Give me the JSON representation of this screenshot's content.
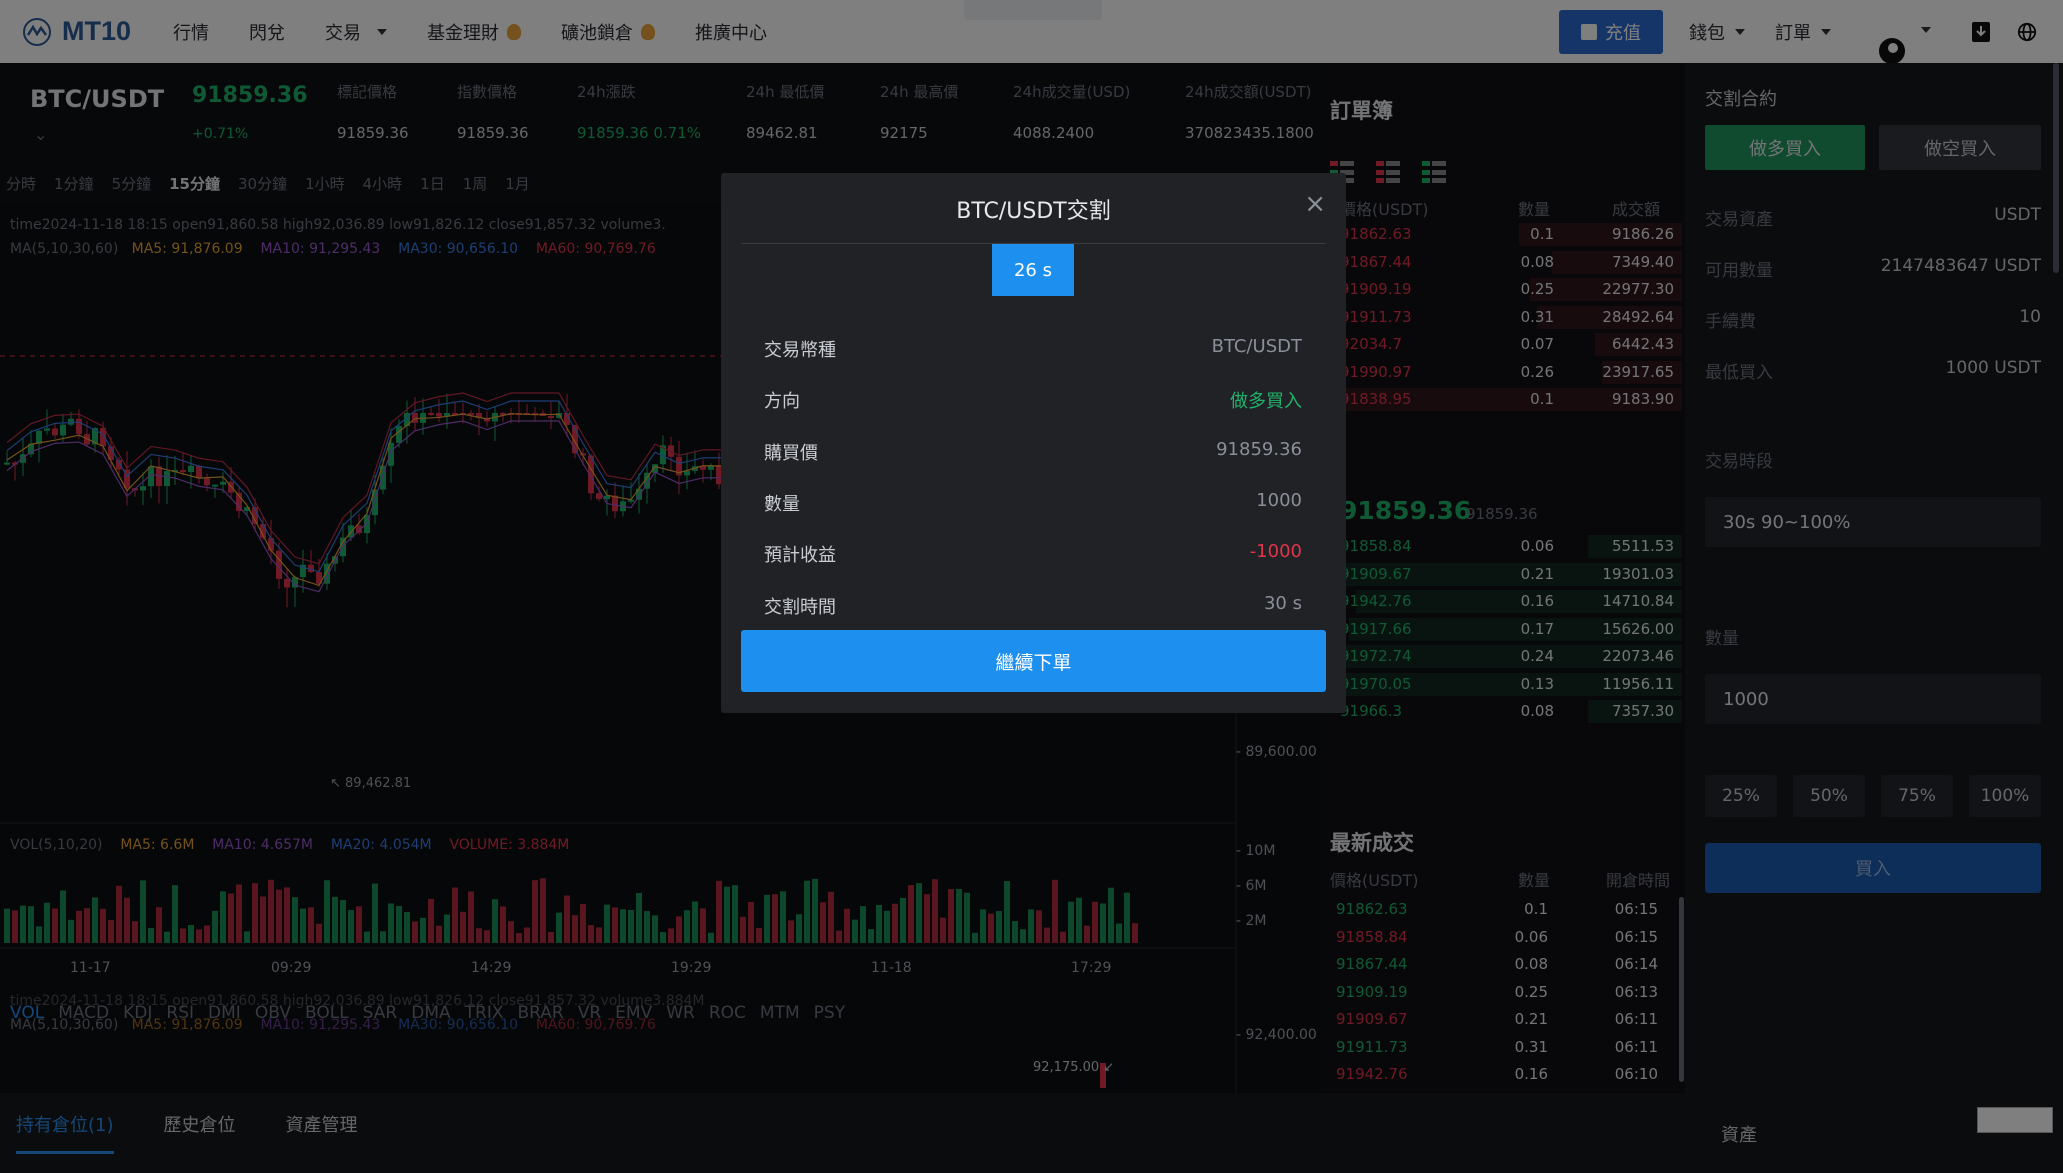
{
  "header": {
    "logo_text": "MT10",
    "nav": [
      {
        "label": "行情"
      },
      {
        "label": "閃兌"
      },
      {
        "label": "交易"
      },
      {
        "label": "基金理財"
      },
      {
        "label": "礦池鎖倉"
      },
      {
        "label": "推廣中心"
      }
    ],
    "charge_label": "充值",
    "wallet_label": "錢包",
    "orders_label": "訂單"
  },
  "ticker": {
    "pair": "BTC/USDT",
    "price": "91859.36",
    "change_pct": "+0.71%",
    "stats": [
      {
        "label": "標記價格",
        "value": "91859.36"
      },
      {
        "label": "指數價格",
        "value": "91859.36"
      },
      {
        "label": "24h漲跌",
        "value": "91859.36  0.71%"
      },
      {
        "label": "24h 最低價",
        "value": "89462.81"
      },
      {
        "label": "24h 最高價",
        "value": "92175"
      },
      {
        "label": "24h成交量(USD)",
        "value": "4088.2400"
      },
      {
        "label": "24h成交額(USDT)",
        "value": "370823435.1800"
      }
    ]
  },
  "timeframes": [
    "分時",
    "1分鐘",
    "5分鐘",
    "15分鐘",
    "30分鐘",
    "1小時",
    "4小時",
    "1日",
    "1周",
    "1月"
  ],
  "active_timeframe": "15分鐘",
  "chart": {
    "ohlc_line": "time2024-11-18 18:15    open91,860.58    high92,036.89    low91,826.12    close91,857.32    volume3.",
    "ma_prefix": "MA(5,10,30,60)",
    "ma5": "MA5: 91,876.09",
    "ma10": "MA10: 91,295.43",
    "ma30": "MA30: 90,656.10",
    "ma60": "MA60: 90,769.76",
    "low_marker": "89,462.81",
    "price_tick": "89,600.00",
    "vol_prefix": "VOL(5,10,20)",
    "vol_ma5": "MA5: 6.6M",
    "vol_ma10": "MA10: 4.657M",
    "vol_ma20": "MA20: 4.054M",
    "vol_volume": "VOLUME: 3.884M",
    "vol_ticks": [
      "10M",
      "6M",
      "2M"
    ],
    "time_labels": [
      "11-17",
      "09:29",
      "14:29",
      "19:29",
      "11-18",
      "17:29"
    ],
    "ohlc_line2": "time2024-11-18 18:15    open91,860.58    high92,036.89    low91,826.12    close91,857.32    volume3.884M",
    "ma_line2_prefix": "MA(5,10,30,60)",
    "ma5_2": "MA5: 91,876.09",
    "ma10_2": "MA10: 91,295.43",
    "ma30_2": "MA30: 90,656.10",
    "ma60_2": "MA60: 90,769.76",
    "price_tick2": "92,400.00",
    "high_marker": "92,175.00"
  },
  "indicators": [
    "VOL",
    "MACD",
    "KDJ",
    "RSI",
    "DMI",
    "OBV",
    "BOLL",
    "SAR",
    "DMA",
    "TRIX",
    "BRAR",
    "VR",
    "EMV",
    "WR",
    "ROC",
    "MTM",
    "PSY"
  ],
  "orderbook": {
    "title": "訂單簿",
    "headers": {
      "price": "價格(USDT)",
      "qty": "數量",
      "total": "成交額"
    },
    "asks": [
      {
        "price": "91862.63",
        "qty": "0.1",
        "total": "9186.26",
        "depth": 0.45
      },
      {
        "price": "91867.44",
        "qty": "0.08",
        "total": "7349.40",
        "depth": 0.36
      },
      {
        "price": "91909.19",
        "qty": "0.25",
        "total": "22977.30",
        "depth": 0.42
      },
      {
        "price": "91911.73",
        "qty": "0.31",
        "total": "28492.64",
        "depth": 0.4
      },
      {
        "price": "92034.7",
        "qty": "0.07",
        "total": "6442.43",
        "depth": 0.24
      },
      {
        "price": "91990.97",
        "qty": "0.26",
        "total": "23917.65",
        "depth": 0.22
      },
      {
        "price": "91838.95",
        "qty": "0.1",
        "total": "9183.90",
        "depth": 1.0
      }
    ],
    "mid_price": "91859.36",
    "mid_sub": "91859.36",
    "bids": [
      {
        "price": "91858.84",
        "qty": "0.06",
        "total": "5511.53",
        "depth": 0.26
      },
      {
        "price": "91909.67",
        "qty": "0.21",
        "total": "19301.03",
        "depth": 1.0
      },
      {
        "price": "91942.76",
        "qty": "0.16",
        "total": "14710.84",
        "depth": 0.9
      },
      {
        "price": "91917.66",
        "qty": "0.17",
        "total": "15626.00",
        "depth": 0.92
      },
      {
        "price": "91972.74",
        "qty": "0.24",
        "total": "22073.46",
        "depth": 0.93
      },
      {
        "price": "91970.05",
        "qty": "0.13",
        "total": "11956.11",
        "depth": 0.93
      },
      {
        "price": "91966.3",
        "qty": "0.08",
        "total": "7357.30",
        "depth": 0.26
      }
    ]
  },
  "trades": {
    "title": "最新成交",
    "headers": {
      "price": "價格(USDT)",
      "qty": "數量",
      "time": "開倉時間"
    },
    "rows": [
      {
        "price": "91862.63",
        "qty": "0.1",
        "time": "06:15",
        "side": "buy"
      },
      {
        "price": "91858.84",
        "qty": "0.06",
        "time": "06:15",
        "side": "sell"
      },
      {
        "price": "91867.44",
        "qty": "0.08",
        "time": "06:14",
        "side": "buy"
      },
      {
        "price": "91909.19",
        "qty": "0.25",
        "time": "06:13",
        "side": "buy"
      },
      {
        "price": "91909.67",
        "qty": "0.21",
        "time": "06:11",
        "side": "sell"
      },
      {
        "price": "91911.73",
        "qty": "0.31",
        "time": "06:11",
        "side": "buy"
      },
      {
        "price": "91942.76",
        "qty": "0.16",
        "time": "06:10",
        "side": "sell"
      }
    ]
  },
  "trade_panel": {
    "title": "交割合約",
    "long_label": "做多買入",
    "short_label": "做空買入",
    "asset_label": "交易資產",
    "asset_value": "USDT",
    "available_label": "可用數量",
    "available_value": "2147483647 USDT",
    "fee_label": "手續費",
    "fee_value": "10",
    "min_label": "最低買入",
    "min_value": "1000 USDT",
    "period_label": "交易時段",
    "period_value": "30s 90~100%",
    "qty_label": "數量",
    "qty_value": "1000",
    "pct": [
      "25%",
      "50%",
      "75%",
      "100%"
    ],
    "buy_label": "買入"
  },
  "bottom": {
    "tabs": [
      "持有倉位(1)",
      "歷史倉位",
      "資產管理"
    ],
    "asset_label": "資產"
  },
  "modal": {
    "title": "BTC/USDT交割",
    "timer": "26 s",
    "rows": [
      {
        "label": "交易幣種",
        "value": "BTC/USDT"
      },
      {
        "label": "方向",
        "value": "做多買入"
      },
      {
        "label": "購買價",
        "value": "91859.36"
      },
      {
        "label": "數量",
        "value": "1000"
      },
      {
        "label": "預計收益",
        "value": "-1000"
      },
      {
        "label": "交割時間",
        "value": "30 s"
      }
    ],
    "continue_label": "繼續下單"
  },
  "colors": {
    "up": "#21b36b",
    "down": "#e0354a",
    "accent": "#1d8fef"
  }
}
